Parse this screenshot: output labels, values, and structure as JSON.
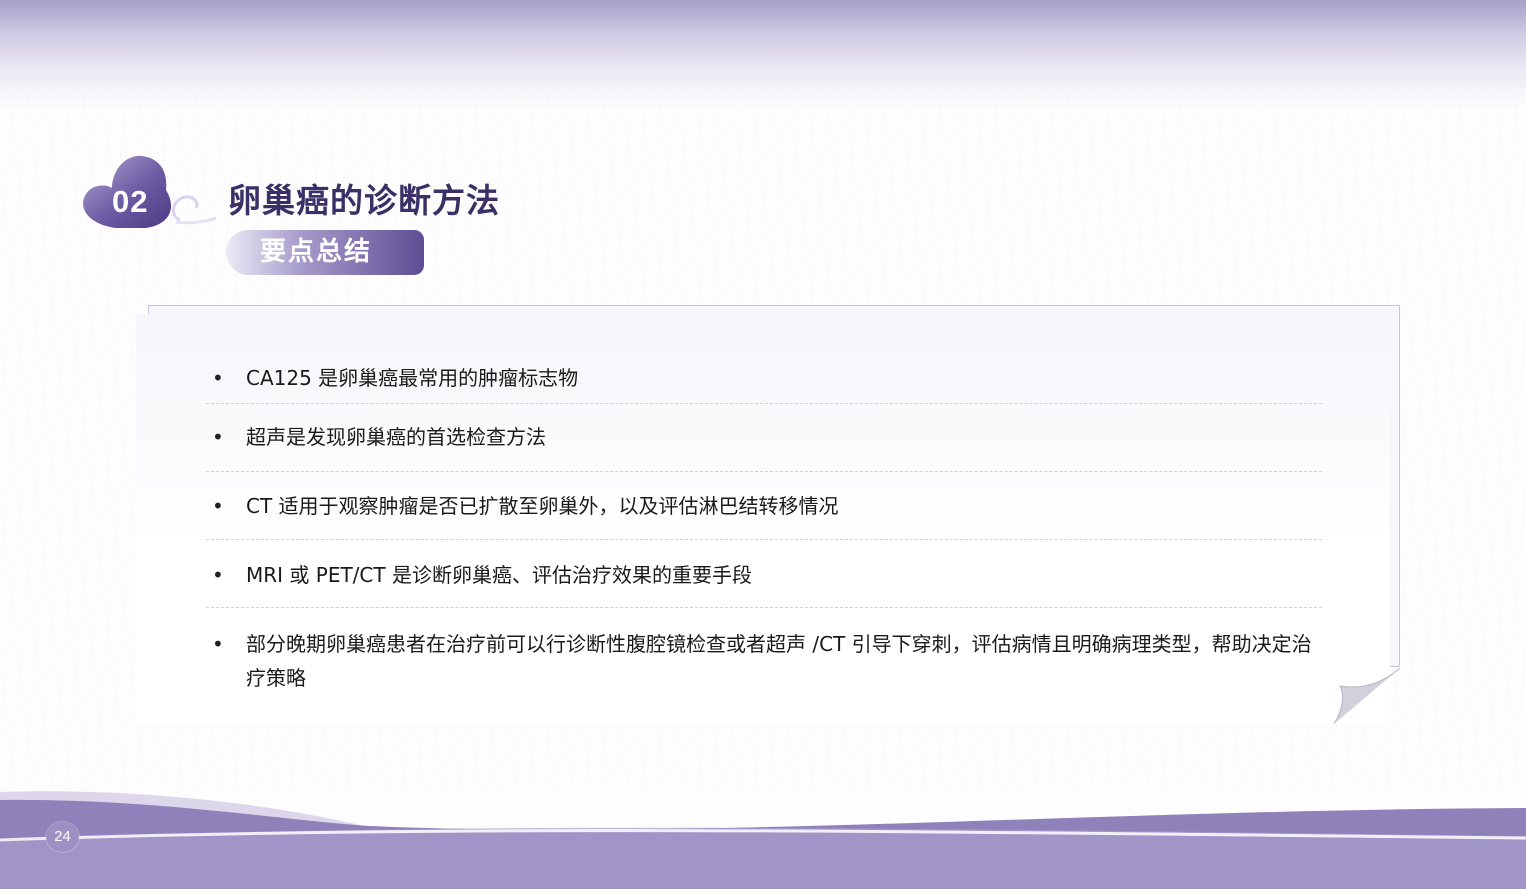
{
  "header": {
    "section_number": "02",
    "title": "卵巢癌的诊断方法",
    "subtitle": "要点总结"
  },
  "content": {
    "items": [
      {
        "text": "CA125 是卵巢癌最常用的肿瘤标志物"
      },
      {
        "text": "超声是发现卵巢癌的首选检查方法"
      },
      {
        "text": "CT 适用于观察肿瘤是否已扩散至卵巢外，以及评估淋巴结转移情况"
      },
      {
        "text": "MRI 或 PET/CT 是诊断卵巢癌、评估治疗效果的重要手段"
      },
      {
        "text": "部分晚期卵巢癌患者在治疗前可以行诊断性腹腔镜检查或者超声 /CT 引导下穿刺，评估病情且明确病理类型，帮助决定治疗策略"
      }
    ],
    "bullet_symbol": "•"
  },
  "footer": {
    "page_number": "24"
  },
  "colors": {
    "accent_dark": "#5e4d93",
    "accent_light": "#a69bcb",
    "title_text": "#3a2f66",
    "wave_dark": "#8a7db7",
    "wave_light": "#d9d4ea"
  },
  "icons": {
    "section_badge": "heart-badge-icon",
    "page_curl": "page-curl-icon"
  }
}
